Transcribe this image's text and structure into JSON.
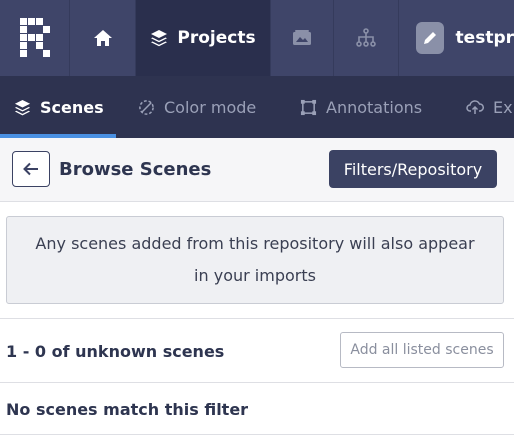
{
  "topbar": {
    "projects_label": "Projects",
    "user_label": "testpr"
  },
  "subnav": {
    "tabs": [
      {
        "label": "Scenes",
        "icon": "layers-icon",
        "active": true
      },
      {
        "label": "Color mode",
        "icon": "color-mode-icon",
        "active": false
      },
      {
        "label": "Annotations",
        "icon": "annotations-icon",
        "active": false
      },
      {
        "label": "Ex",
        "icon": "cloud-upload-icon",
        "active": false
      }
    ]
  },
  "header": {
    "title": "Browse Scenes",
    "filters_label": "Filters/Repository"
  },
  "notice": {
    "text": "Any scenes added from this repository will also appear in your imports"
  },
  "results": {
    "count_text": "1 - 0 of unknown scenes",
    "add_all_label": "Add all listed scenes",
    "empty_text": "No scenes match this filter"
  },
  "colors": {
    "topbar": "#3f4569",
    "active_nav": "#2a2f4d",
    "subnav": "#2e3350",
    "accent": "#4a90e2",
    "primary_button": "#3b4263"
  }
}
